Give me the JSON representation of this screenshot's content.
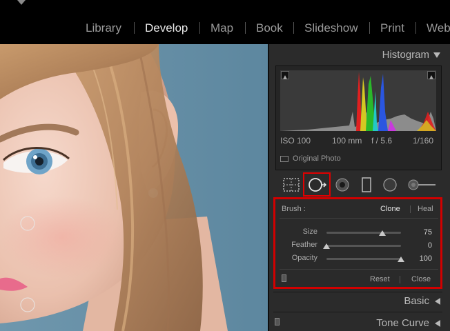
{
  "module_picker": {
    "items": [
      "Library",
      "Develop",
      "Map",
      "Book",
      "Slideshow",
      "Print",
      "Web"
    ],
    "active": "Develop"
  },
  "histogram": {
    "title": "Histogram",
    "iso": "ISO 100",
    "focal_length": "100 mm",
    "aperture": "f / 5.6",
    "shutter": "1/160",
    "original_photo_label": "Original Photo"
  },
  "tool_strip": {
    "tools": [
      "crop-overlay",
      "spot-removal",
      "red-eye",
      "graduated-filter",
      "radial-filter",
      "adjustment-brush"
    ],
    "active": "spot-removal"
  },
  "spot_removal": {
    "brush_label": "Brush :",
    "clone_label": "Clone",
    "heal_label": "Heal",
    "size_label": "Size",
    "size_value": "75",
    "size_fraction": 0.75,
    "feather_label": "Feather",
    "feather_value": "0",
    "feather_fraction": 0.0,
    "opacity_label": "Opacity",
    "opacity_value": "100",
    "opacity_fraction": 1.0,
    "reset_label": "Reset",
    "close_label": "Close"
  },
  "panels": {
    "basic": "Basic",
    "tone_curve": "Tone Curve"
  },
  "colors": {
    "highlight_red": "#d20000",
    "panel_bg": "#2b2b2b",
    "topbar_bg": "#000000"
  }
}
